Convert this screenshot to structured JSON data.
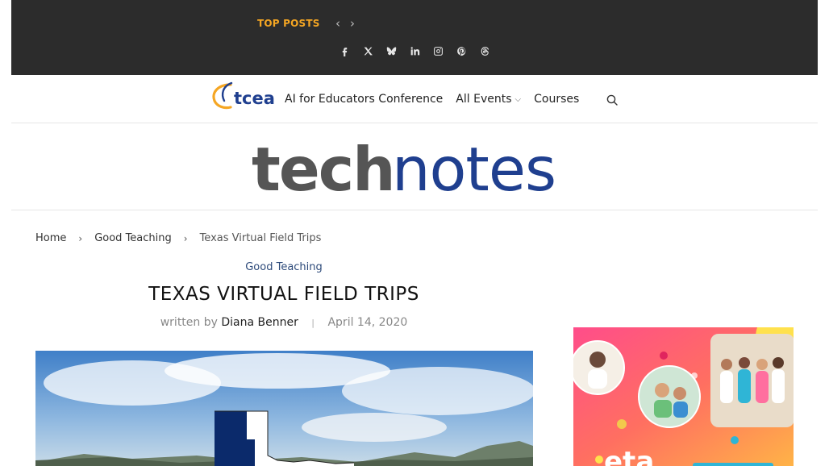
{
  "topbar": {
    "label": "TOP POSTS",
    "prev_icon": "chevron-left-icon",
    "next_icon": "chevron-right-icon",
    "socials": [
      {
        "name": "facebook-icon"
      },
      {
        "name": "x-twitter-icon"
      },
      {
        "name": "bluesky-icon"
      },
      {
        "name": "linkedin-icon"
      },
      {
        "name": "instagram-icon"
      },
      {
        "name": "pinterest-icon"
      },
      {
        "name": "threads-icon"
      }
    ],
    "bg": "#2c2c2c",
    "accent": "#f5a623"
  },
  "nav": {
    "logo_text": "tcea",
    "items": [
      {
        "label": "AI for Educators Conference"
      },
      {
        "label": "All Events"
      },
      {
        "label": "Courses"
      }
    ],
    "search_icon": "search-icon"
  },
  "banner": {
    "part1": "tech",
    "part2": "notes",
    "color1": "#555555",
    "color2": "#1f3f8f"
  },
  "breadcrumb": {
    "items": [
      "Home",
      "Good Teaching",
      "Texas Virtual Field Trips"
    ]
  },
  "article": {
    "category": "Good Teaching",
    "title": "TEXAS VIRTUAL FIELD TRIPS",
    "written_by": "written by",
    "author": "Diana Benner",
    "date": "April 14, 2020"
  },
  "ad": {
    "brand_text": "eta"
  }
}
